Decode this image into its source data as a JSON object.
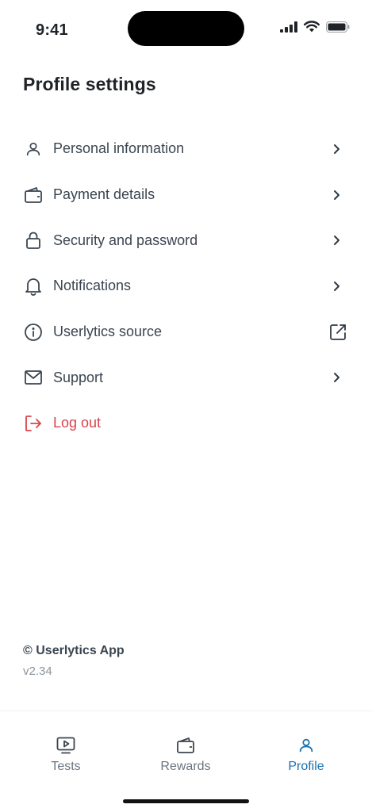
{
  "status_bar": {
    "time": "9:41",
    "icons": [
      "cellular-signal-icon",
      "wifi-icon",
      "battery-icon"
    ]
  },
  "header": {
    "title": "Profile settings"
  },
  "menu": {
    "items": [
      {
        "label": "Personal information",
        "icon": "person-icon",
        "trailing": "chevron-right-icon"
      },
      {
        "label": "Payment details",
        "icon": "wallet-icon",
        "trailing": "chevron-right-icon"
      },
      {
        "label": "Security and password",
        "icon": "lock-icon",
        "trailing": "chevron-right-icon"
      },
      {
        "label": "Notifications",
        "icon": "bell-icon",
        "trailing": "chevron-right-icon"
      },
      {
        "label": "Userlytics source",
        "icon": "info-icon",
        "trailing": "external-link-icon"
      },
      {
        "label": "Support",
        "icon": "mail-icon",
        "trailing": "chevron-right-icon"
      },
      {
        "label": "Log out",
        "icon": "logout-icon",
        "trailing": ""
      }
    ]
  },
  "footer": {
    "copyright": "© Userlytics App",
    "version": "v2.34"
  },
  "tab_bar": {
    "tabs": [
      {
        "label": "Tests",
        "icon": "play-video-icon",
        "active": false
      },
      {
        "label": "Rewards",
        "icon": "wallet-icon",
        "active": false
      },
      {
        "label": "Profile",
        "icon": "person-icon",
        "active": true
      }
    ]
  },
  "colors": {
    "text": "#3b4550",
    "title": "#1f2328",
    "danger": "#d9434a",
    "accent": "#1a73b0",
    "muted": "#8a939c",
    "tab_inactive": "#6b7580"
  }
}
